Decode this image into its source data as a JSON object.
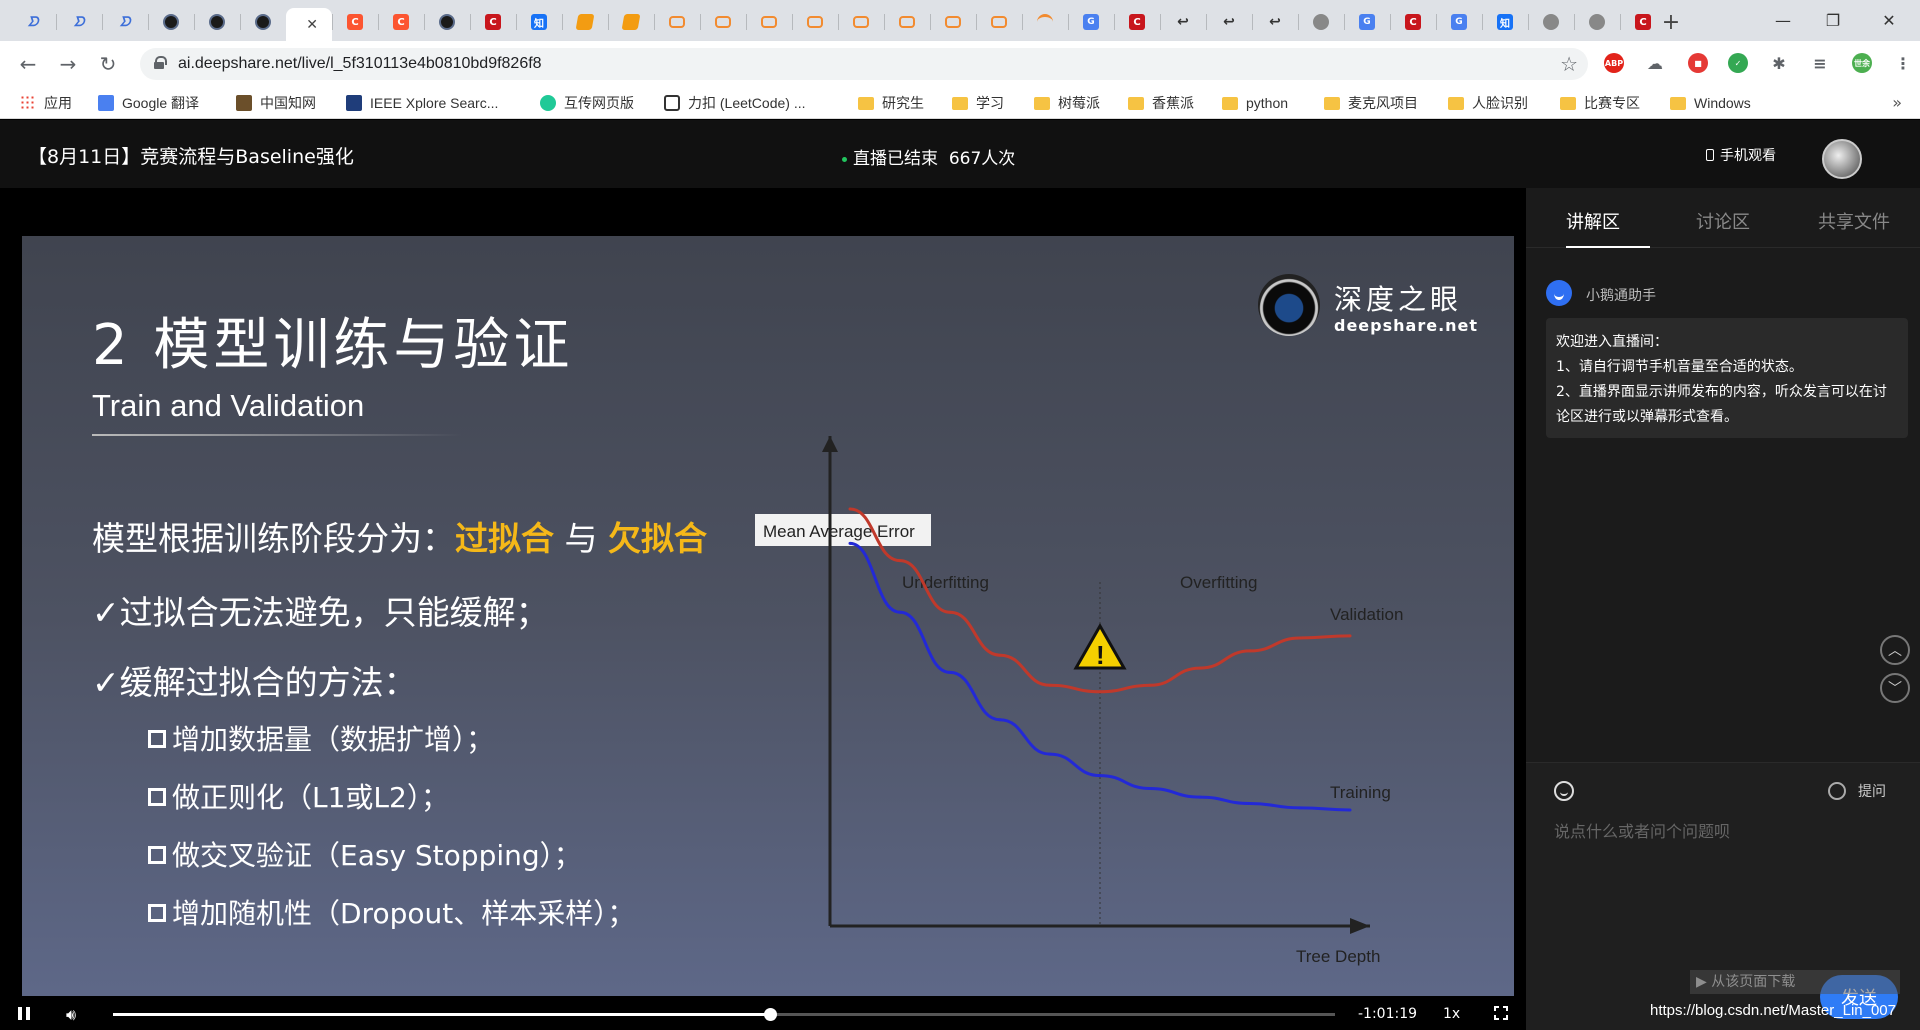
{
  "browser": {
    "tabs": [
      {
        "icon": "deepshare-icon",
        "glyph": "ᗤ"
      },
      {
        "icon": "deepshare-icon",
        "glyph": "ᗤ"
      },
      {
        "icon": "deepshare-icon",
        "glyph": "ᗤ"
      },
      {
        "icon": "camera-icon",
        "glyph": ""
      },
      {
        "icon": "camera-icon",
        "glyph": ""
      },
      {
        "icon": "camera-icon",
        "glyph": ""
      },
      {
        "icon": "active",
        "glyph": ""
      },
      {
        "icon": "csdn-icon",
        "glyph": "C"
      },
      {
        "icon": "csdn-icon",
        "glyph": "C"
      },
      {
        "icon": "camera-icon",
        "glyph": ""
      },
      {
        "icon": "c-icon",
        "glyph": "C"
      },
      {
        "icon": "zhihu-icon",
        "glyph": "知"
      },
      {
        "icon": "book-icon",
        "glyph": ""
      },
      {
        "icon": "book-icon",
        "glyph": ""
      },
      {
        "icon": "link-icon",
        "glyph": ""
      },
      {
        "icon": "link-icon",
        "glyph": ""
      },
      {
        "icon": "link-icon",
        "glyph": ""
      },
      {
        "icon": "link-icon",
        "glyph": ""
      },
      {
        "icon": "link-icon",
        "glyph": ""
      },
      {
        "icon": "link-icon",
        "glyph": ""
      },
      {
        "icon": "link-icon",
        "glyph": ""
      },
      {
        "icon": "link-icon",
        "glyph": ""
      },
      {
        "icon": "moon-icon",
        "glyph": ""
      },
      {
        "icon": "translate-icon",
        "glyph": "G"
      },
      {
        "icon": "c-icon",
        "glyph": "C"
      },
      {
        "icon": "leetcode-icon",
        "glyph": "↩"
      },
      {
        "icon": "leetcode-icon",
        "glyph": "↩"
      },
      {
        "icon": "leetcode-icon",
        "glyph": "↩"
      },
      {
        "icon": "globe-icon",
        "glyph": ""
      },
      {
        "icon": "translate-icon",
        "glyph": "G"
      },
      {
        "icon": "c-icon",
        "glyph": "C"
      },
      {
        "icon": "translate-icon",
        "glyph": "G"
      },
      {
        "icon": "zhihu-icon",
        "glyph": "知"
      },
      {
        "icon": "globe-icon",
        "glyph": ""
      },
      {
        "icon": "globe-icon",
        "glyph": ""
      },
      {
        "icon": "c-icon",
        "glyph": "C"
      }
    ],
    "active_tab_close": "✕",
    "new_tab": "+",
    "window_controls": {
      "minimize": "—",
      "maximize": "❐",
      "close": "✕"
    },
    "url": "ai.deepshare.net/live/l_5f310113e4b0810bd9f826f8",
    "extensions": [
      {
        "name": "abp-icon",
        "label": "ABP",
        "color": "#e2231a"
      },
      {
        "name": "cloud-icon",
        "label": "☁",
        "color": "#5f6368"
      },
      {
        "name": "red-ext-icon",
        "label": "■",
        "color": "#e53935"
      },
      {
        "name": "shield-icon",
        "label": "✓",
        "color": "#34a853"
      },
      {
        "name": "puzzle-icon",
        "label": "✱",
        "color": "#5f6368"
      },
      {
        "name": "queue-icon",
        "label": "≡",
        "color": "#5f6368"
      },
      {
        "name": "profile-icon",
        "label": "世余",
        "color": "#4caf50"
      },
      {
        "name": "menu-icon",
        "label": "⋮",
        "color": "#5f6368"
      }
    ],
    "bookmarks": [
      {
        "label": "应用",
        "icon": "apps"
      },
      {
        "label": "Google 翻译",
        "icon": "translate"
      },
      {
        "label": "中国知网",
        "icon": "cnki"
      },
      {
        "label": "IEEE Xplore Searc...",
        "icon": "ieee"
      },
      {
        "label": "互传网页版",
        "icon": "transfer"
      },
      {
        "label": "力扣 (LeetCode) ...",
        "icon": "leetcode"
      },
      {
        "label": "研究生",
        "icon": "folder"
      },
      {
        "label": "学习",
        "icon": "folder"
      },
      {
        "label": "树莓派",
        "icon": "folder"
      },
      {
        "label": "香蕉派",
        "icon": "folder"
      },
      {
        "label": "python",
        "icon": "folder"
      },
      {
        "label": "麦克风项目",
        "icon": "folder"
      },
      {
        "label": "人脸识别",
        "icon": "folder"
      },
      {
        "label": "比赛专区",
        "icon": "folder"
      },
      {
        "label": "Windows",
        "icon": "folder"
      }
    ],
    "bookmarks_more": "»"
  },
  "live": {
    "title": "【8月11日】竞赛流程与Baseline强化",
    "status": "直播已结束",
    "viewers": "667人次",
    "mobile_watch": "手机观看"
  },
  "slide": {
    "title": "2 模型训练与验证",
    "subtitle": "Train and Validation",
    "logo_cn": "深度之眼",
    "logo_en": "deepshare.net",
    "line1_prefix": "模型根据训练阶段分为：",
    "line1_overfit": "过拟合",
    "line1_and": " 与 ",
    "line1_underfit": "欠拟合",
    "line2": "✓过拟合无法避免，只能缓解；",
    "line3": "✓缓解过拟合的方法：",
    "methods": [
      "增加数据量（数据扩增）；",
      "做正则化（L1或L2）；",
      "做交叉验证（Easy Stopping）；",
      "增加随机性（Dropout、样本采样）；"
    ]
  },
  "chart_data": {
    "type": "line",
    "title": "Mean Average Error",
    "xlabel": "Tree Depth",
    "ylabel": "",
    "regions": [
      "Underfitting",
      "Overfitting"
    ],
    "x": [
      0,
      1,
      2,
      3,
      4,
      5,
      6,
      7,
      8,
      9,
      10
    ],
    "series": [
      {
        "name": "Validation",
        "values": [
          9.0,
          7.8,
          6.6,
          5.6,
          4.9,
          4.75,
          4.9,
          5.3,
          5.7,
          6.0,
          6.05
        ],
        "color": "#c0392b"
      },
      {
        "name": "Training",
        "values": [
          8.2,
          6.6,
          5.2,
          4.1,
          3.3,
          2.8,
          2.5,
          2.3,
          2.15,
          2.05,
          2.0
        ],
        "color": "#2329d6"
      }
    ],
    "annotation": "warning-icon",
    "optimum_x": 5,
    "ylim": [
      0,
      10
    ],
    "xlim": [
      0,
      10
    ]
  },
  "player": {
    "progress": 0.538,
    "time": "-1:01:19",
    "speed": "1x"
  },
  "sidebar": {
    "tabs": [
      "讲解区",
      "讨论区",
      "共享文件"
    ],
    "message_sender": "小鹅通助手",
    "message_lines": [
      "欢迎进入直播间：",
      "1、请自行调节手机音量至合适的状态。",
      "2、直播界面显示讲师发布的内容，听众发言可以在讨论区进行或以弹幕形式查看。"
    ],
    "scroll_up": "︿",
    "scroll_down": "﹀",
    "ask_label": "提问",
    "input_placeholder": "说点什么或者问个问题呗",
    "send_label": "发送",
    "download_banner": "▶ 从该页面下载",
    "watermark": "https://blog.csdn.net/Master_Lin_007"
  },
  "colors": {
    "accent_orange": "#f5b818",
    "send_blue": "#2f7cf6",
    "live_green": "#22c55e"
  }
}
